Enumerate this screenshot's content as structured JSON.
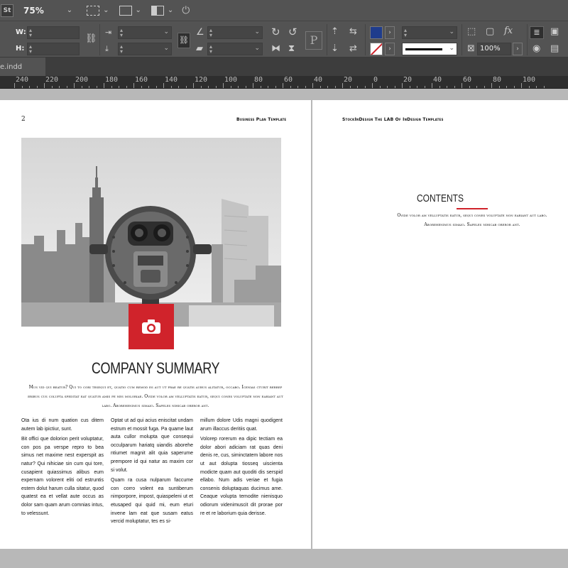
{
  "app_bar": {
    "logo": "St",
    "zoom": "75%",
    "icons": [
      "view-options-icon",
      "screen-mode-icon",
      "arrange-documents-icon",
      "publish-icon"
    ]
  },
  "control_bar": {
    "w_label": "W:",
    "h_label": "H:",
    "stroke_weight_placeholder": "",
    "opacity": "100%",
    "fill_color": "#1f3c8c",
    "stroke_color": "#d0232b"
  },
  "document_tab": {
    "label": "e.indd"
  },
  "ruler": {
    "ticks": [
      "240",
      "220",
      "200",
      "180",
      "160",
      "140",
      "120",
      "100",
      "80",
      "60",
      "40",
      "20",
      "0",
      "20",
      "40",
      "60",
      "80",
      "100"
    ]
  },
  "left_page": {
    "page_number": "2",
    "header": "Business Plan Template",
    "title": "COMPANY SUMMARY",
    "intro": "Mus vid qui beatur? Qui to cori tesequi et, quatio cum remod es aut ut prae re quatis aubus alitatur, occabo. Icenias cturit rerrep eribus cus colupta speditat eat quatur amis pe nes moloriae. Ovide volor am velluptatis eatur, sequi cones voluptate non eariant aut labo. Aborehenimus simaio. Sapeles nihicab oreror ant.",
    "columns": [
      [
        "Ota ius di num quation cus ditem autem lab ipictiur, sunt.",
        "Bit offici que dolorion perit voluptatur, con pos pa verspe repro to bea simus net maxime nest experspit as natur? Qui nihiciae sin cum qui tore, cusapient quiassimus alibus eum expernam volorent eliti od estruntis estem dolut harum culla sitatur, quod quatest ea et vellat aute occus as dolor sam quam arum comnias intus, to velessunt."
      ],
      [
        "Optat ut ad qui acius eniscitat undam estrum et mossit fuga. Pa quame laut auta cullor molupta que consequi occulparum hariatq uiandis aborehe ntiumet magnit alit quia saperume prempore id qui natur as maxim cor si volut.",
        "Quam ra cusa nulparum faccume con corro volent ea suntiberum nimporpore, impost, quiaspeleni ut et etusaped qui quid mi, eum eturi invene lam eat que susam eatus vercid moluptatur, tes es si-"
      ],
      [
        "millum dolore Udis magni quodigent arum illaccus deritiis quat.",
        "Volorep rorerum ea dipic tectiam ea dolor abori adiciam rat quas deni denis re, cus, siminctatem labore nos ut aut dolupta tiosseq uiscienta modicte quam aut quoditi dis serspid ellabo. Num adis veriae et fugia consenis doluptaquas ducimus ame. Ceaque volupta temodite nienisquo odiorum videnimuscit dit prorae por re et re laborium quia derisse."
      ]
    ]
  },
  "right_page": {
    "header": "StockInDesign The LAB Of InDesign Templates",
    "contents_title": "CONTENTS",
    "contents_text": "Ovide volor am velluptatis eatur, sequi cones voluptate non eariant aut labo. Aborehenimus simaio. Sapeles nihicab oreror ant."
  }
}
